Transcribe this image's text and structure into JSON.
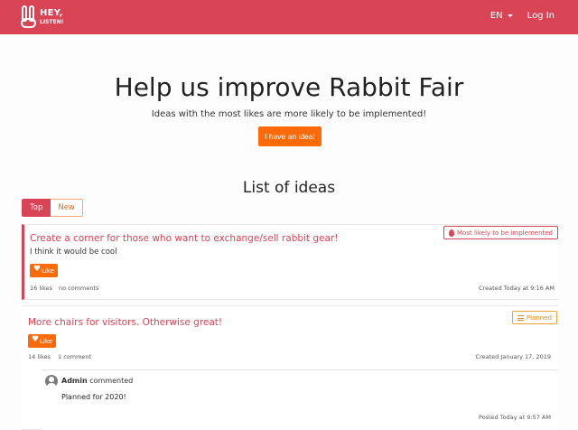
{
  "nav": {
    "logo_line1": "HEY,",
    "logo_line2": "LISTEN!",
    "lang": "EN",
    "login": "Log In",
    "brand_color": "#d84456"
  },
  "hero": {
    "title": "Help us improve Rabbit Fair",
    "subtitle": "Ideas with the most likes are more likely to be implemented!",
    "idea_button": "I have an idea!",
    "accent_color": "#fd6a08"
  },
  "list": {
    "title": "List of ideas",
    "tabs": [
      {
        "label": "Top",
        "active": true
      },
      {
        "label": "New",
        "active": false
      }
    ]
  },
  "ideas": [
    {
      "title": "Create a corner for those who want to exchange/sell rabbit gear!",
      "text": "I think it would be cool",
      "badge": "Most likely to be implemented",
      "badge_icon": "fire-icon",
      "like_label": "Like",
      "likes": "16 likes",
      "comments": "no comments",
      "created": "Created Today at 9:16 AM"
    },
    {
      "title": "More chairs for visitors. Otherwise great!",
      "badge": "Planned",
      "badge_icon": "list-icon",
      "like_label": "Like",
      "likes": "14 likes",
      "comments": "1 comment",
      "created": "Created January 17, 2019",
      "comment": {
        "author": "Admin",
        "action": "commented",
        "text": "Planned for 2020!",
        "posted": "Posted Today at 9:57 AM"
      }
    }
  ]
}
